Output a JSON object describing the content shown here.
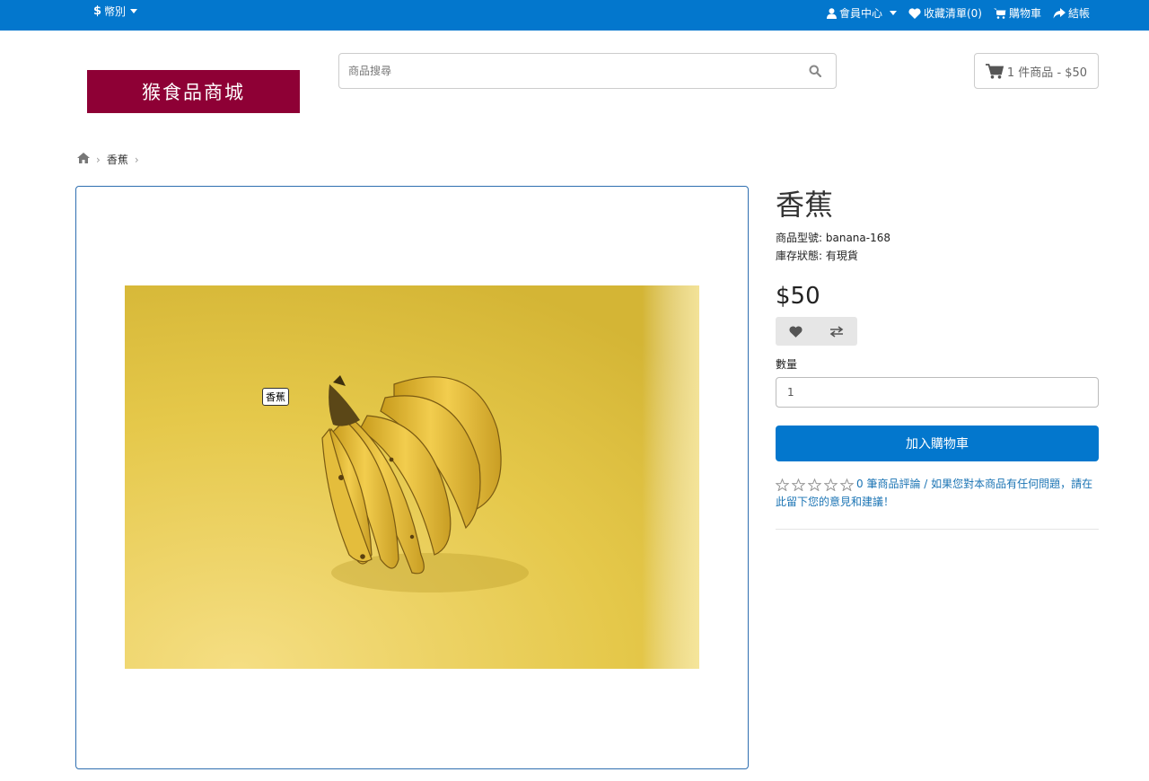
{
  "topbar": {
    "currency_label": "幣別",
    "links": {
      "account": "會員中心",
      "wishlist": "收藏清單(0)",
      "cart": "購物車",
      "checkout": "結帳"
    }
  },
  "header": {
    "logo_text": "猴食品商城",
    "search_placeholder": "商品搜尋",
    "cart_summary": "1 件商品 - $50"
  },
  "breadcrumb": {
    "items": [
      "香蕉"
    ]
  },
  "product": {
    "name": "香蕉",
    "image_alt": "香蕉",
    "model_label": "商品型號:",
    "model_value": "banana-168",
    "stock_label": "庫存狀態:",
    "stock_value": "有現貨",
    "price": "$50",
    "quantity_label": "數量",
    "quantity_value": "1",
    "add_to_cart": "加入購物車",
    "rating": 0,
    "reviews_text": "0 筆商品評論",
    "review_prompt": " / 如果您對本商品有任何問題，請在此留下您的意見和建議！"
  },
  "colors": {
    "brand_blue": "#0377cd",
    "logo_bg": "#8e0035"
  }
}
